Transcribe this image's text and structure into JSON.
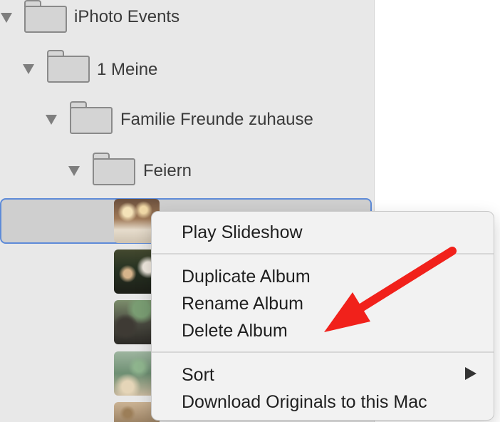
{
  "sidebar": {
    "items": [
      {
        "label": "iPhoto Events",
        "icon": "folder-icon"
      },
      {
        "label": "1 Meine",
        "icon": "folder-icon"
      },
      {
        "label": "Familie Freunde zuhause",
        "icon": "folder-icon"
      },
      {
        "label": "Feiern",
        "icon": "folder-icon"
      }
    ]
  },
  "context_menu": {
    "items": [
      {
        "label": "Play Slideshow"
      },
      {
        "label": "Duplicate Album"
      },
      {
        "label": "Rename Album"
      },
      {
        "label": "Delete Album"
      },
      {
        "label": "Sort"
      },
      {
        "label": "Download Originals to this Mac"
      }
    ]
  },
  "colors": {
    "sidebar_bg": "#e8e8e8",
    "selection_border": "#5e8bd8",
    "menu_bg": "#f2f2f2",
    "annotation_arrow": "#f1211b"
  }
}
